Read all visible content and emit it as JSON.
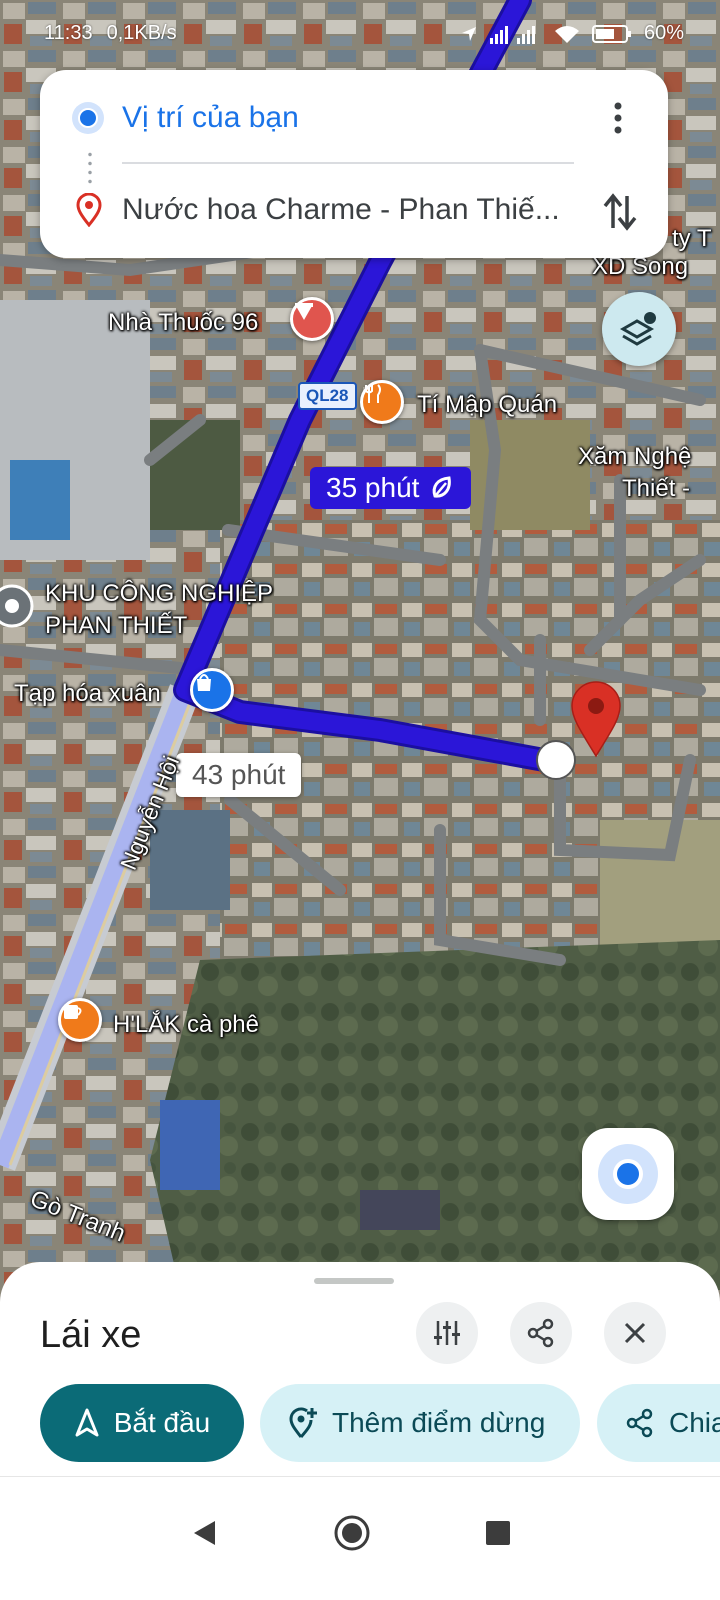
{
  "status_bar": {
    "time": "11:33",
    "speed": "0,1KB/s",
    "battery": "60%"
  },
  "directions": {
    "origin": "Vị trí của bạn",
    "destination": "Nước hoa Charme - Phan Thiế..."
  },
  "map": {
    "route_badge_primary": "35 phút",
    "route_badge_alt": "43 phút",
    "highway_shield": "QL28",
    "labels": {
      "nha_thuoc": "Nhà Thuốc 96",
      "ti_map": "Tí Mập Quán",
      "xam_nghe_1": "Xăm Nghệ",
      "xam_nghe_2": "Thiết -",
      "cty_1": "ty T",
      "cty_2": "XD Song",
      "khu_cn_1": "KHU CÔNG NGHIỆP",
      "khu_cn_2": "PHAN THIẾT",
      "tap_hoa": "Tạp hóa xuân",
      "nguyen_hoi": "Nguyễn Hội",
      "hlak": "H'LẮK cà phê",
      "go_tranh": "Gò Tranh"
    },
    "colors": {
      "route_primary": "#2b16d8",
      "route_alt": "#aab4f0",
      "destination_pin": "#d93025"
    }
  },
  "sheet": {
    "mode_title": "Lái xe",
    "start_label": "Bắt đầu",
    "add_stop_label": "Thêm điểm dừng",
    "share_label": "Chia sẻ"
  },
  "icons": {
    "status": [
      "wifi-icon",
      "signal-icon",
      "battery-icon",
      "location-icon"
    ],
    "card": [
      "origin-dot-icon",
      "destination-pin-icon",
      "more-vert-icon",
      "swap-icon"
    ],
    "sheet": [
      "tune-icon",
      "share-icon",
      "close-icon",
      "navigate-icon",
      "add-location-icon"
    ],
    "nav": [
      "back-icon",
      "home-icon",
      "recents-icon"
    ]
  }
}
